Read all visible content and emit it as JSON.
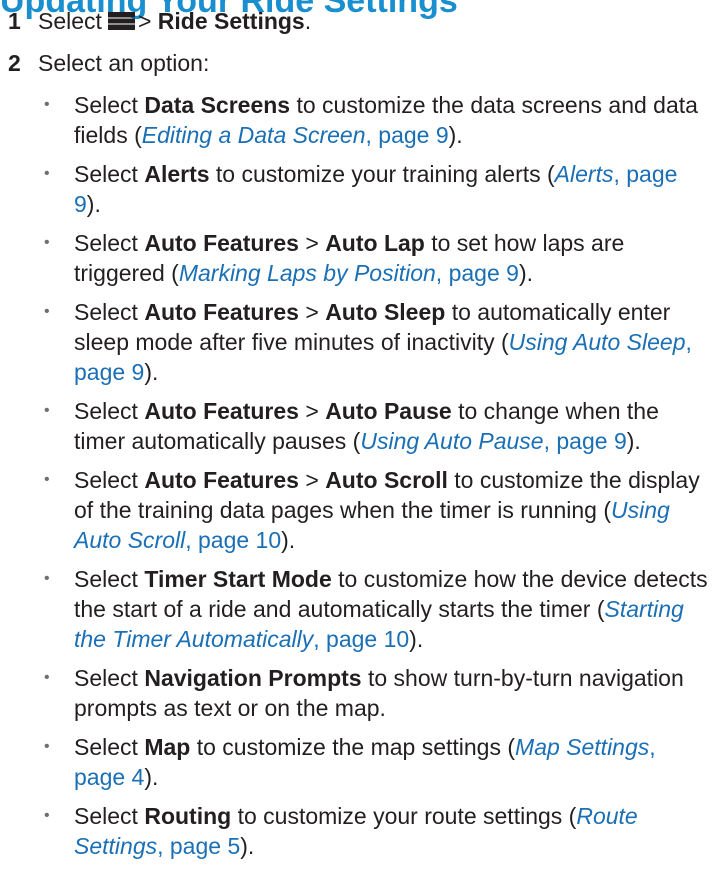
{
  "heading": "Updating Your Ride Settings",
  "step1": {
    "number": "1",
    "text_pre": "Select",
    "icon": "menu-icon",
    "sep": ">",
    "target": "Ride Settings",
    "end": "."
  },
  "step2": {
    "number": "2",
    "text": "Select an option:"
  },
  "options": [
    {
      "pre": "Select ",
      "b1": "Data Screens",
      "mid": "",
      "b2": "",
      "desc": " to customize the data screens and data fields (",
      "link": "Editing a Data Screen",
      "page": ", page 9",
      "tail": ")."
    },
    {
      "pre": "Select ",
      "b1": "Alerts",
      "mid": "",
      "b2": "",
      "desc": " to customize your training alerts (",
      "link": "Alerts",
      "page": ", page 9",
      "tail": ")."
    },
    {
      "pre": "Select ",
      "b1": "Auto Features",
      "mid": " > ",
      "b2": "Auto Lap",
      "desc": " to set how laps are triggered (",
      "link": "Marking Laps by Position",
      "page": ", page 9",
      "tail": ")."
    },
    {
      "pre": "Select ",
      "b1": "Auto Features",
      "mid": " > ",
      "b2": "Auto Sleep",
      "desc": " to automatically enter sleep mode after five minutes of inactivity (",
      "link": "Using Auto Sleep",
      "page": ", page 9",
      "tail": ")."
    },
    {
      "pre": "Select ",
      "b1": "Auto Features",
      "mid": " > ",
      "b2": "Auto Pause",
      "desc": " to change when the timer automatically pauses (",
      "link": "Using Auto Pause",
      "page": ", page 9",
      "tail": ")."
    },
    {
      "pre": "Select ",
      "b1": "Auto Features",
      "mid": " > ",
      "b2": "Auto Scroll",
      "desc": " to customize the display of the training data pages when the timer is running (",
      "link": "Using Auto Scroll",
      "page": ", page 10",
      "tail": ")."
    },
    {
      "pre": "Select ",
      "b1": "Timer Start Mode",
      "mid": "",
      "b2": "",
      "desc": " to customize how the device detects the start of a ride and automatically starts the timer (",
      "link": "Starting the Timer Automatically",
      "page": ", page 10",
      "tail": ")."
    },
    {
      "pre": "Select ",
      "b1": "Navigation Prompts",
      "mid": "",
      "b2": "",
      "desc": " to show turn-by-turn navigation prompts as text or on the map.",
      "link": "",
      "page": "",
      "tail": ""
    },
    {
      "pre": "Select ",
      "b1": "Map",
      "mid": "",
      "b2": "",
      "desc": " to customize the map settings (",
      "link": "Map Settings",
      "page": ", page 4",
      "tail": ")."
    },
    {
      "pre": "Select ",
      "b1": "Routing",
      "mid": "",
      "b2": "",
      "desc": " to customize your route settings (",
      "link": "Route Settings",
      "page": ", page 5",
      "tail": ")."
    }
  ]
}
